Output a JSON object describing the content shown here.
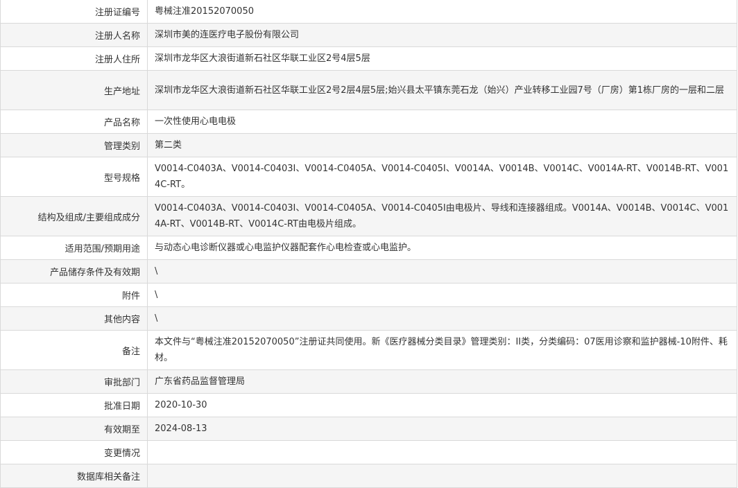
{
  "rows": [
    {
      "label": "注册证编号",
      "value": "粤械注准20152070050"
    },
    {
      "label": "注册人名称",
      "value": "深圳市美的连医疗电子股份有限公司"
    },
    {
      "label": "注册人住所",
      "value": "深圳市龙华区大浪街道新石社区华联工业区2号4层5层"
    },
    {
      "label": "生产地址",
      "value": "深圳市龙华区大浪街道新石社区华联工业区2号2层4层5层;始兴县太平镇东莞石龙（始兴）产业转移工业园7号（厂房）第1栋厂房的一层和二层"
    },
    {
      "label": "产品名称",
      "value": "一次性使用心电电极"
    },
    {
      "label": "管理类别",
      "value": "第二类"
    },
    {
      "label": "型号规格",
      "value": "V0014-C0403A、V0014-C0403I、V0014-C0405A、V0014-C0405I、V0014A、V0014B、V0014C、V0014A-RT、V0014B-RT、V0014C-RT。"
    },
    {
      "label": "结构及组成/主要组成成分",
      "value": "V0014-C0403A、V0014-C0403I、V0014-C0405A、V0014-C0405I由电极片、导线和连接器组成。V0014A、V0014B、V0014C、V0014A-RT、V0014B-RT、V0014C-RT由电极片组成。"
    },
    {
      "label": "适用范围/预期用途",
      "value": "与动态心电诊断仪器或心电监护仪器配套作心电检查或心电监护。"
    },
    {
      "label": "产品储存条件及有效期",
      "value": "\\"
    },
    {
      "label": "附件",
      "value": "\\"
    },
    {
      "label": "其他内容",
      "value": "\\"
    },
    {
      "label": "备注",
      "value": "本文件与“粤械注准20152070050”注册证共同使用。新《医疗器械分类目录》管理类别：II类，分类编码：07医用诊察和监护器械-10附件、耗材。"
    },
    {
      "label": "审批部门",
      "value": "广东省药品监督管理局"
    },
    {
      "label": "批准日期",
      "value": "2020-10-30"
    },
    {
      "label": "有效期至",
      "value": "2024-08-13"
    },
    {
      "label": "变更情况",
      "value": ""
    },
    {
      "label": "数据库相关备注",
      "value": ""
    }
  ]
}
